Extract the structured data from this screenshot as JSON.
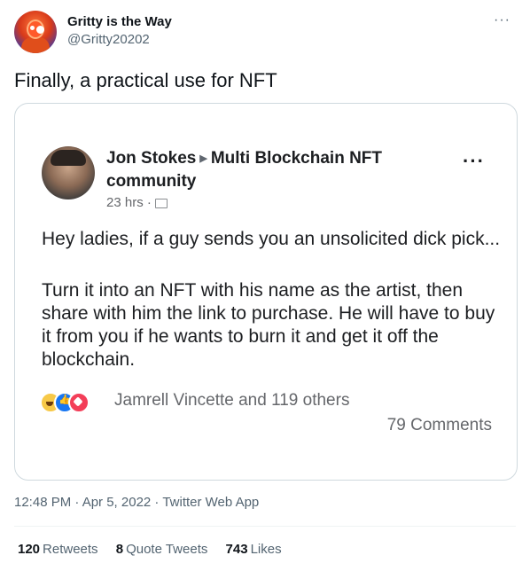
{
  "user": {
    "display_name": "Gritty is the Way",
    "handle": "@Gritty20202"
  },
  "more_icon": "more-horizontal-icon",
  "tweet": {
    "text": "Finally, a practical use for NFT",
    "meta": "12:48 PM · Apr 5, 2022 · Twitter Web App"
  },
  "screenshot": {
    "author": "Jon Stokes",
    "group": "Multi Blockchain NFT community",
    "time": "23 hrs ·",
    "paragraph_1": "Hey ladies, if a guy sends you an unsolicited dick pick...",
    "paragraph_2": "Turn it into an NFT with his name as the artist, then share with him the link to purchase. He will have to buy it from you if he wants to burn it and get it off the blockchain.",
    "reactors": "Jamrell Vincette and 119 others",
    "comments": "79 Comments"
  },
  "stats": {
    "retweets_count": "120",
    "retweets_label": "Retweets",
    "quote_count": "8",
    "quote_label": "Quote Tweets",
    "likes_count": "743",
    "likes_label": "Likes"
  }
}
